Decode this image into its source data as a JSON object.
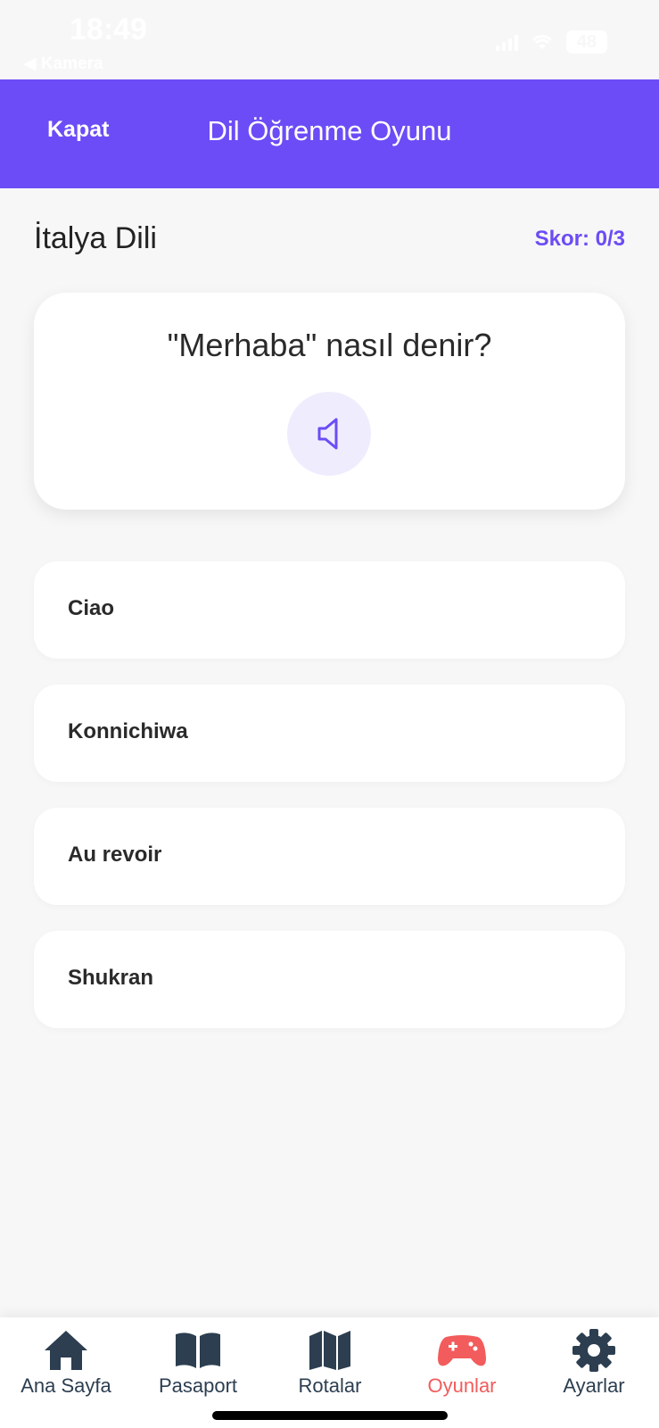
{
  "status_bar": {
    "time": "18:49",
    "back_label": "◀ Kamera",
    "battery": "48"
  },
  "header": {
    "close_label": "Kapat",
    "title": "Dil Öğrenme Oyunu",
    "background": "#6c4cf6"
  },
  "game": {
    "language": "İtalya Dili",
    "score": "Skor: 0/3",
    "question": "\"Merhaba\" nasıl denir?",
    "sound_icon": "speaker-icon",
    "options": [
      {
        "label": "Ciao"
      },
      {
        "label": "Konnichiwa"
      },
      {
        "label": "Au revoir"
      },
      {
        "label": "Shukran"
      }
    ]
  },
  "tab_bar": {
    "active_color": "#f25c5c",
    "inactive_color": "#2c3e50",
    "tabs": [
      {
        "label": "Ana Sayfa",
        "icon": "home-icon",
        "active": false
      },
      {
        "label": "Pasaport",
        "icon": "book-icon",
        "active": false
      },
      {
        "label": "Rotalar",
        "icon": "map-icon",
        "active": false
      },
      {
        "label": "Oyunlar",
        "icon": "gamepad-icon",
        "active": true
      },
      {
        "label": "Ayarlar",
        "icon": "gear-icon",
        "active": false
      }
    ]
  }
}
